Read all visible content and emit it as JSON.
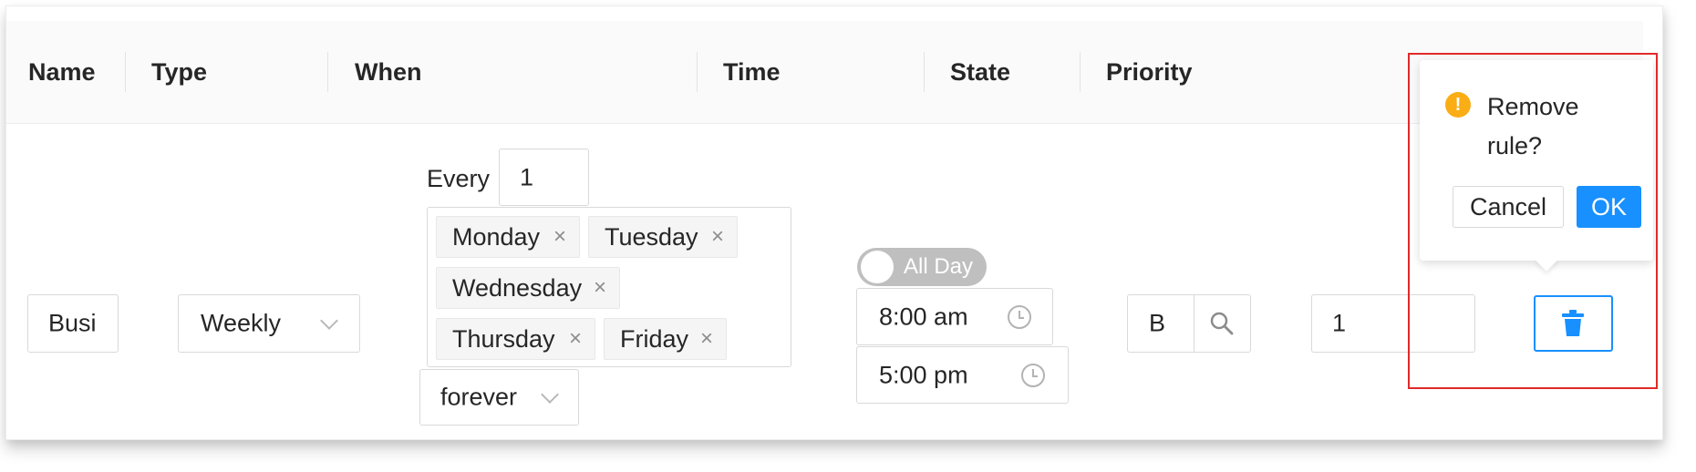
{
  "table": {
    "headers": [
      "Name",
      "Type",
      "When",
      "Time",
      "State",
      "Priority"
    ]
  },
  "row": {
    "name_value": "Busi",
    "type_value": "Weekly",
    "every_label": "Every",
    "every_value": "1",
    "days": [
      "Monday",
      "Tuesday",
      "Wednesday",
      "Thursday",
      "Friday"
    ],
    "tag_remove_glyph": "×",
    "duration_value": "forever",
    "all_day_label": "All Day",
    "all_day_on": false,
    "start_time": "8:00 am",
    "end_time": "5:00 pm",
    "state_value": "B",
    "priority_value": "1"
  },
  "popconfirm": {
    "message_line1": "Remove",
    "message_line2": "rule?",
    "warn_glyph": "!",
    "cancel_label": "Cancel",
    "ok_label": "OK"
  },
  "icons": {
    "type_dropdown": "chevron-down-icon",
    "duration_dropdown": "chevron-down-icon",
    "start_time": "clock-icon",
    "end_time": "clock-icon",
    "state_search": "search-icon",
    "delete": "trash-icon",
    "warning": "exclamation-circle-icon"
  },
  "colors": {
    "primary": "#1890ff",
    "warning": "#faad14",
    "highlight_outline": "#e02a2a",
    "toggle_off": "#bfbfbf"
  }
}
